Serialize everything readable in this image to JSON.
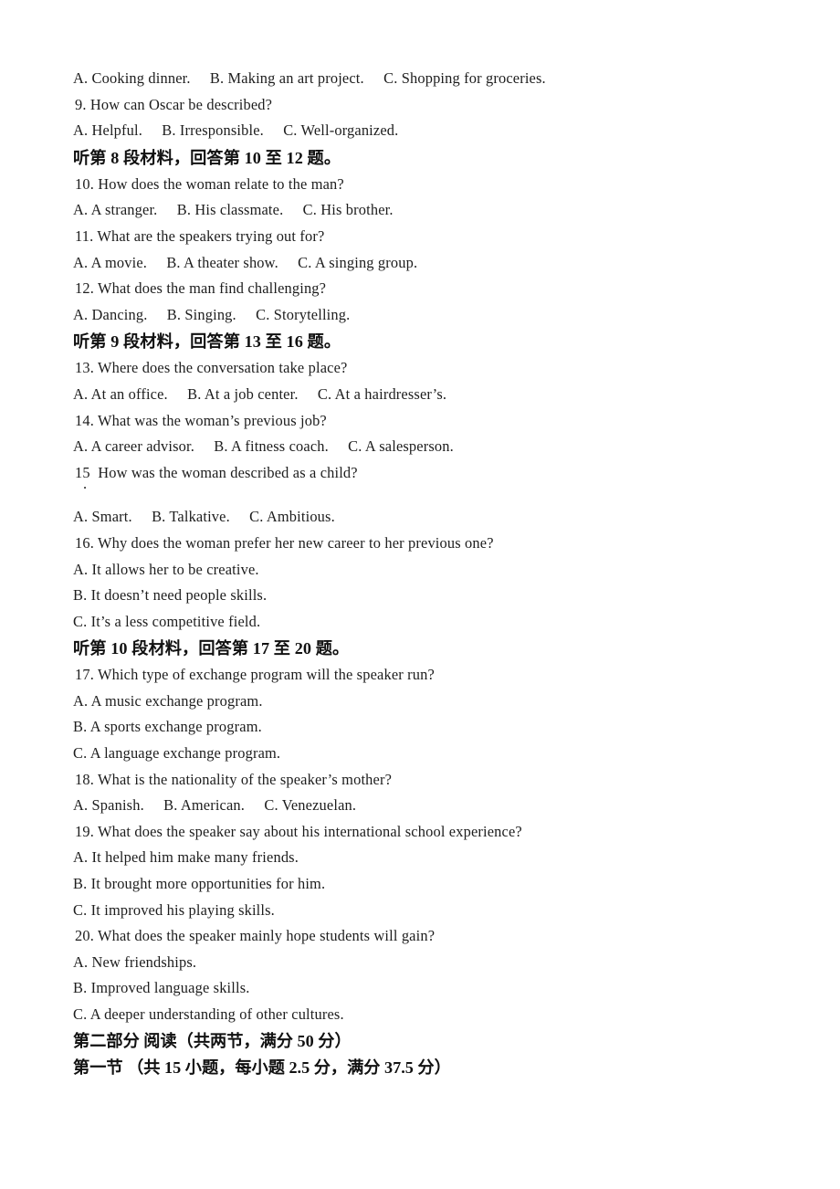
{
  "document": {
    "type": "exam-paper",
    "language_mix": "english-chinese",
    "background_color": "#ffffff",
    "text_color": "#1d1d1d"
  },
  "lines": {
    "l01_q8_options": "A. Cooking dinner.     B. Making an art project.     C. Shopping for groceries.",
    "l02_q9": "9. How can Oscar be described?",
    "l03_q9_options": "A. Helpful.     B. Irresponsible.     C. Well-organized.",
    "l04_head8": "听第 8 段材料，回答第 10 至 12 题。",
    "l05_q10": "10. How does the woman relate to the man?",
    "l06_q10_options": "A. A stranger.     B. His classmate.     C. His brother.",
    "l07_q11": "11. What are the speakers trying out for?",
    "l08_q11_options": "A. A movie.     B. A theater show.     C. A singing group.",
    "l09_q12": "12. What does the man find challenging?",
    "l10_q12_options": "A. Dancing.     B. Singing.     C. Storytelling.",
    "l11_head9": "听第 9 段材料，回答第 13 至 16 题。",
    "l12_q13": "13. Where does the conversation take place?",
    "l13_q13_options": "A. At an office.     B. At a job center.     C. At a hairdresser’s.",
    "l14_q14": "14. What was the woman’s previous job?",
    "l15_q14_options": "A. A career advisor.     B. A fitness coach.     C. A salesperson.",
    "l16_q15": "15  How was the woman described as a child?",
    "l16_q15_stray_period": ".",
    "l17_q15_options": "A. Smart.     B. Talkative.     C. Ambitious.",
    "l18_q16": "16. Why does the woman prefer her new career to her previous one?",
    "l19_q16_a": "A. It allows her to be creative.",
    "l20_q16_b": "B. It doesn’t need people skills.",
    "l21_q16_c": "C. It’s a less competitive field.",
    "l22_head10": "听第 10 段材料，回答第 17 至 20 题。",
    "l23_q17": "17. Which type of exchange program will the speaker run?",
    "l24_q17_a": "A. A music exchange program.",
    "l25_q17_b": "B. A sports exchange program.",
    "l26_q17_c": "C. A language exchange program.",
    "l27_q18": "18. What is the nationality of the speaker’s mother?",
    "l28_q18_options": "A. Spanish.     B. American.     C. Venezuelan.",
    "l29_q19": "19. What does the speaker say about his international school experience?",
    "l30_q19_a": "A. It helped him make many friends.",
    "l31_q19_b": "B. It brought more opportunities for him.",
    "l32_q19_c": "C. It improved his playing skills.",
    "l33_q20": "20. What does the speaker mainly hope students will gain?",
    "l34_q20_a": "A. New friendships.",
    "l35_q20_b": "B. Improved language skills.",
    "l36_q20_c": "C. A deeper understanding of other cultures.",
    "l37_part2": "第二部分 阅读（共两节，满分 50 分）",
    "l38_section1": "第一节 （共 15 小题，每小题 2.5 分，满分 37.5 分）"
  }
}
